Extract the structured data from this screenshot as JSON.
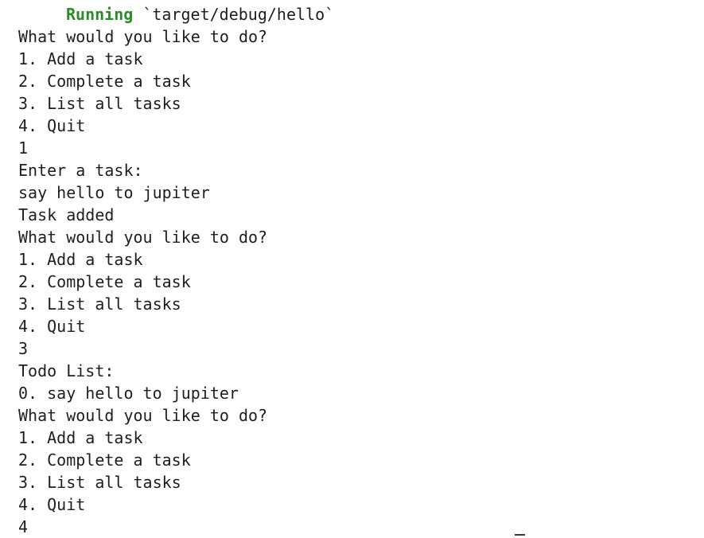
{
  "terminal": {
    "running_word": "Running",
    "running_path": " `target/debug/hello`",
    "lines": [
      "What would you like to do?",
      "1. Add a task",
      "2. Complete a task",
      "3. List all tasks",
      "4. Quit",
      "1",
      "Enter a task:",
      "say hello to jupiter",
      "Task added",
      "What would you like to do?",
      "1. Add a task",
      "2. Complete a task",
      "3. List all tasks",
      "4. Quit",
      "3",
      "Todo List:",
      "0. say hello to jupiter",
      "What would you like to do?",
      "1. Add a task",
      "2. Complete a task",
      "3. List all tasks",
      "4. Quit",
      "4"
    ]
  },
  "colors": {
    "background": "#ffffff",
    "text": "#1e1e1e",
    "running_accent": "#2e8b28"
  }
}
